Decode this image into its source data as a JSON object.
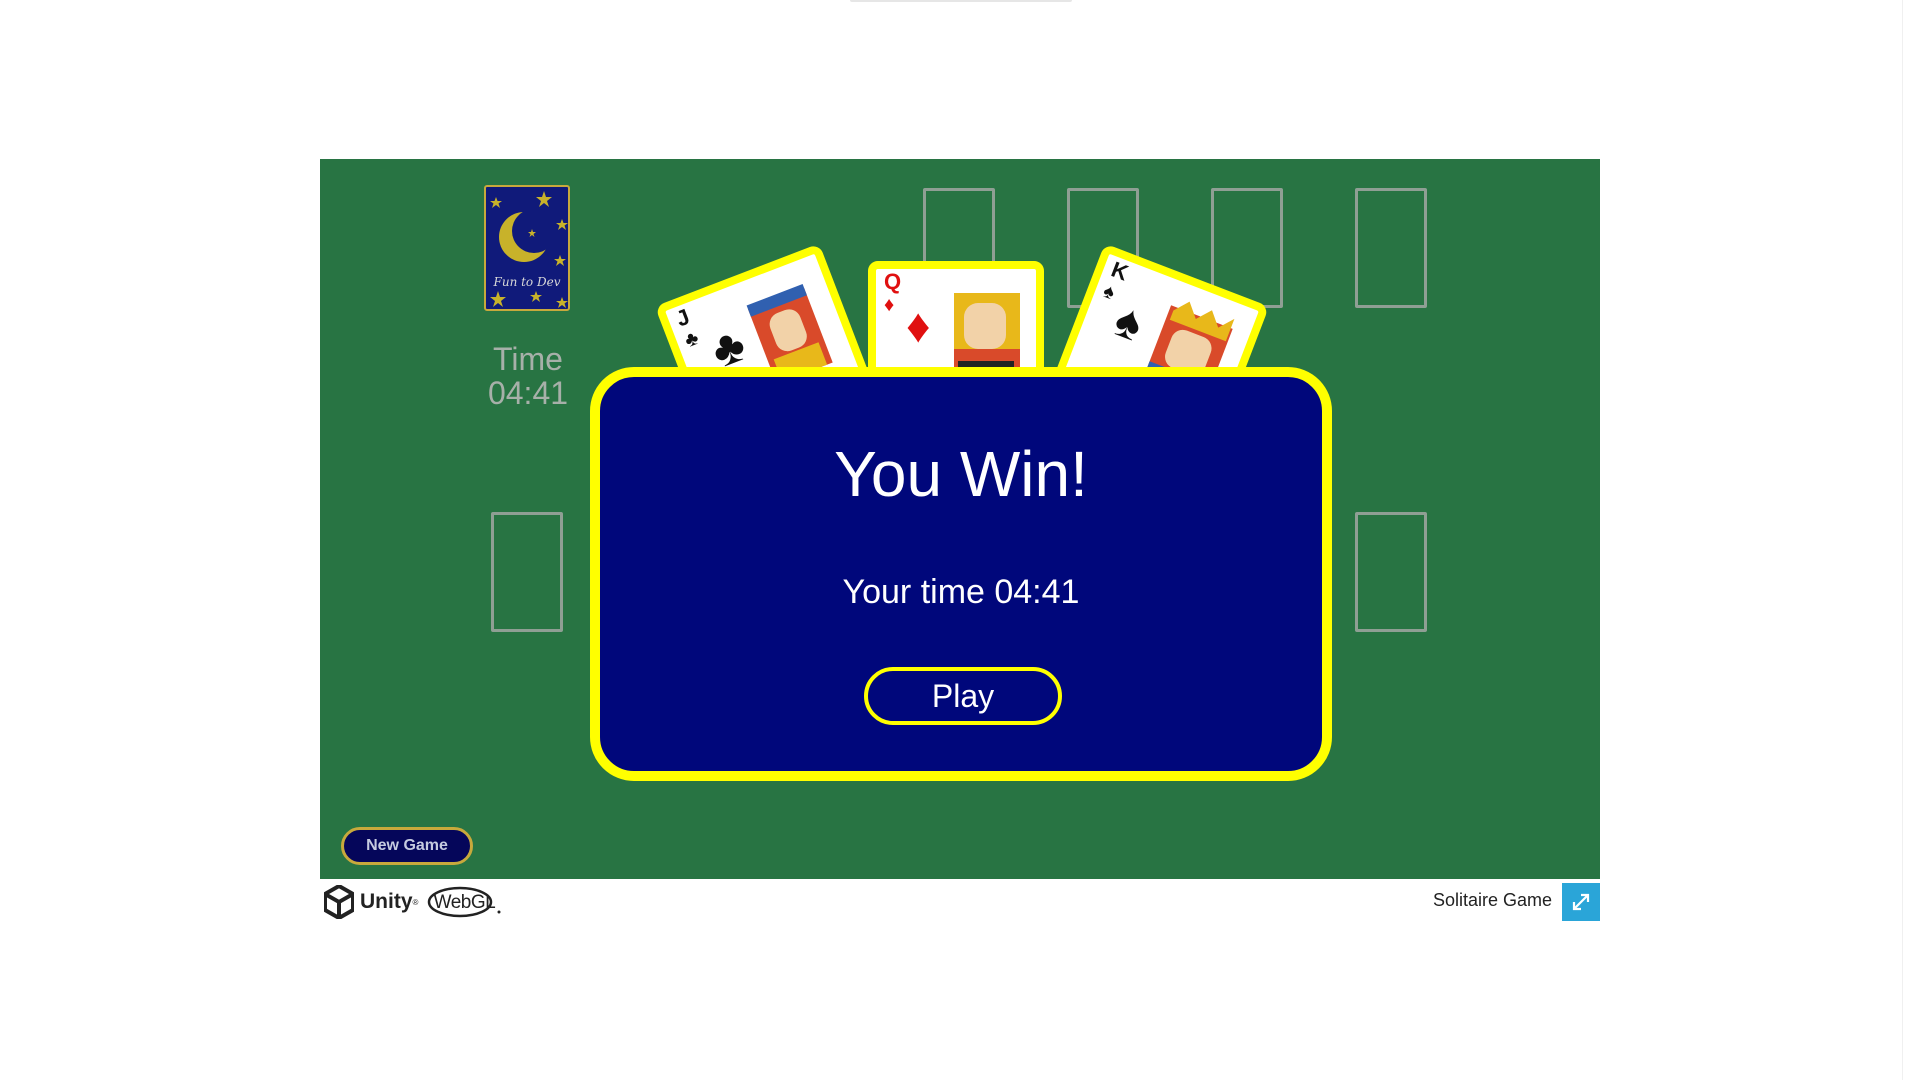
{
  "game": {
    "stock": {
      "back_text": "Fun to Dev"
    },
    "timer": {
      "label": "Time",
      "value": "04:41"
    },
    "win_cards": [
      {
        "rank": "J",
        "suit": "♣",
        "color": "black"
      },
      {
        "rank": "Q",
        "suit": "♦",
        "color": "red"
      },
      {
        "rank": "K",
        "suit": "♠",
        "color": "black"
      }
    ],
    "win_dialog": {
      "title": "You Win!",
      "time_text": "Your time 04:41",
      "play_label": "Play"
    },
    "new_game_label": "New Game"
  },
  "footer": {
    "unity_label": "Unity",
    "unity_tm": "®",
    "webgl_label": "WebGL",
    "build_title": "Solitaire Game",
    "fullscreen_icon": "expand-icon"
  },
  "colors": {
    "table_green": "#287443",
    "panel_navy": "#00077b",
    "accent_yellow": "#ffff00",
    "fullscreen_blue": "#2aa5d8"
  }
}
